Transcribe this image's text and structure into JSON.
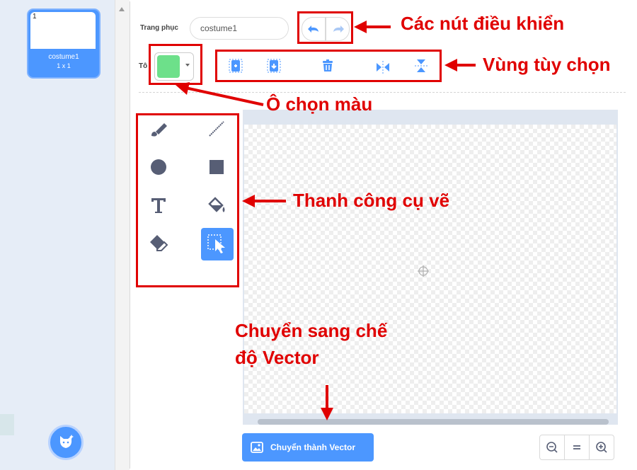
{
  "costume_list": {
    "selected": {
      "number": "1",
      "name": "costume1",
      "size": "1 x 1"
    }
  },
  "editor": {
    "costume_label": "Trang phục",
    "costume_name_value": "costume1",
    "fill_label": "Tô",
    "fill_color": "#6de08a",
    "convert_button": "Chuyển thành Vector",
    "zoom": {
      "out_icon": "zoom-out-icon",
      "reset_icon": "zoom-reset-icon",
      "in_icon": "zoom-in-icon"
    }
  },
  "annotations": {
    "controls": "Các nút điều khiển",
    "options": "Vùng tùy chọn",
    "color_picker": "Ô chọn màu",
    "toolbar": "Thanh công cụ vẽ",
    "vector_line1": "Chuyển sang chế",
    "vector_line2": "độ Vector",
    "accent_color": "#e00000"
  },
  "colors": {
    "accent_blue": "#4c97ff",
    "panel_bg": "#e6edf7"
  }
}
